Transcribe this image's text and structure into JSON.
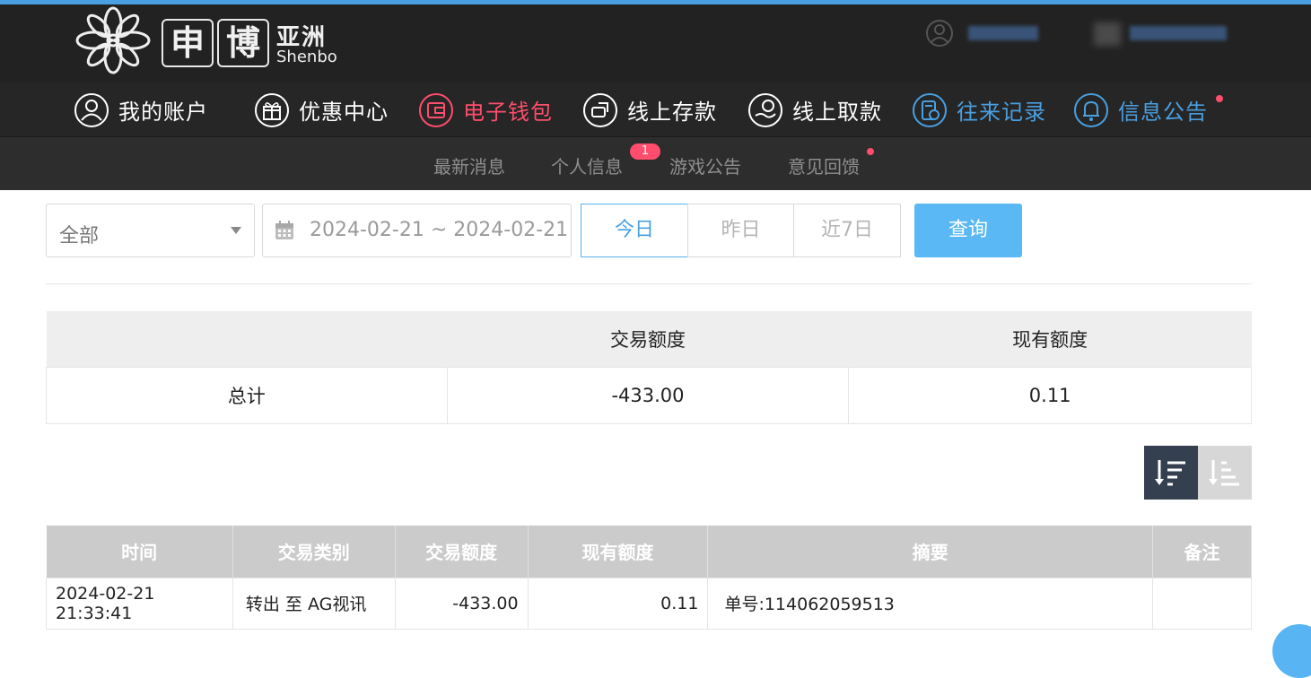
{
  "header": {
    "logo_char1": "申",
    "logo_char2": "博",
    "logo_cn": "亚洲",
    "logo_en": "Shenbo"
  },
  "main_nav": [
    {
      "label": "我的账户",
      "icon": "user-icon",
      "color": "#ffffff"
    },
    {
      "label": "优惠中心",
      "icon": "gift-icon",
      "color": "#ffffff"
    },
    {
      "label": "电子钱包",
      "icon": "wallet-icon",
      "color": "#ff4d6d"
    },
    {
      "label": "线上存款",
      "icon": "deposit-icon",
      "color": "#ffffff"
    },
    {
      "label": "线上取款",
      "icon": "withdraw-icon",
      "color": "#ffffff"
    },
    {
      "label": "往来记录",
      "icon": "records-icon",
      "color": "#4a9fe0"
    },
    {
      "label": "信息公告",
      "icon": "bell-icon",
      "color": "#4a9fe0"
    }
  ],
  "sub_nav": {
    "items": [
      "最新消息",
      "个人信息",
      "游戏公告",
      "意见回馈"
    ],
    "badge_count": "1"
  },
  "filters": {
    "type_selected": "全部",
    "date_range": "2024-02-21 ~ 2024-02-21",
    "quick_ranges": [
      "今日",
      "昨日",
      "近7日"
    ],
    "active_range": "今日",
    "search_label": "查询"
  },
  "summary": {
    "headers": [
      "",
      "交易额度",
      "现有额度"
    ],
    "row_label": "总计",
    "amount": "-433.00",
    "balance": "0.11"
  },
  "records": {
    "headers": [
      "时间",
      "交易类别",
      "交易额度",
      "现有额度",
      "摘要",
      "备注"
    ],
    "rows": [
      {
        "time": "2024-02-21 21:33:41",
        "type": "转出 至 AG视讯",
        "amount": "-433.00",
        "balance": "0.11",
        "summary": "单号:114062059513",
        "note": ""
      }
    ]
  },
  "colors": {
    "accent_blue": "#4a9fe0",
    "accent_red": "#ff4d6d",
    "header_bg": "#222222"
  }
}
